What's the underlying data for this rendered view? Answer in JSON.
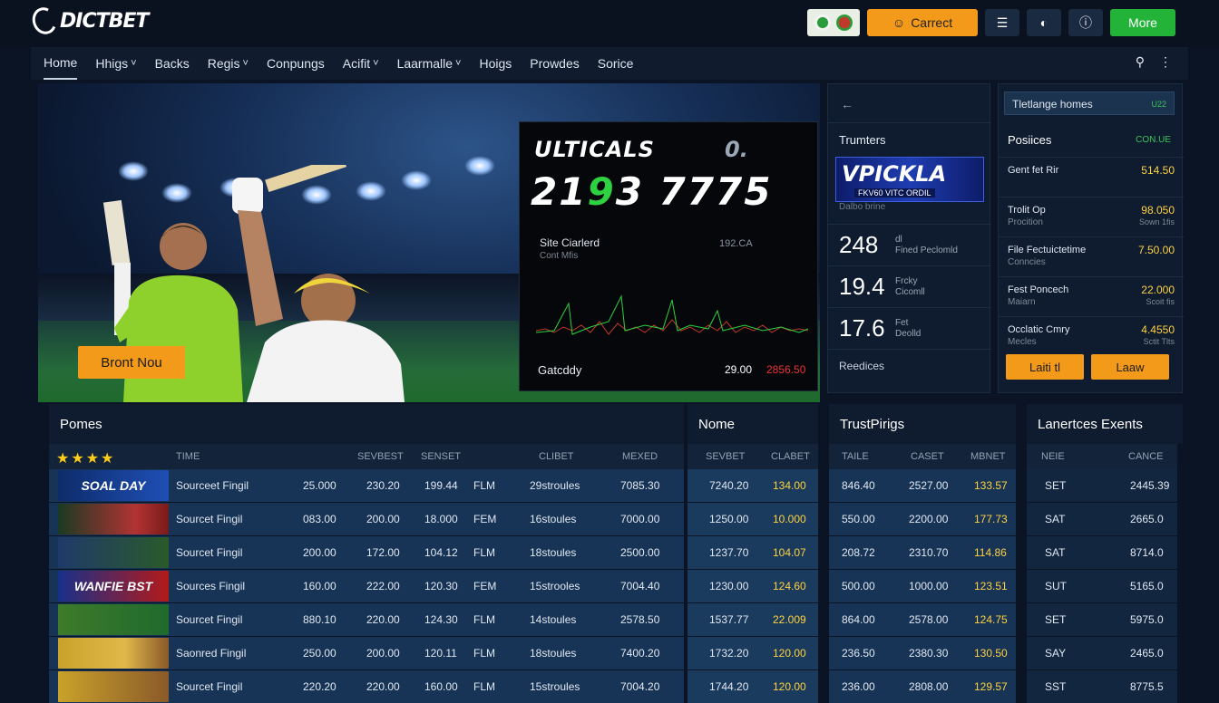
{
  "app": {
    "logo": "DICTBET"
  },
  "topbar": {
    "primary_label": "Carrect",
    "more_label": "More"
  },
  "nav": {
    "items": [
      {
        "label": "Home",
        "dropdown": false
      },
      {
        "label": "Hhigs",
        "dropdown": true
      },
      {
        "label": "Backs",
        "dropdown": false
      },
      {
        "label": "Regis",
        "dropdown": true
      },
      {
        "label": "Conpungs",
        "dropdown": false
      },
      {
        "label": "Acifit",
        "dropdown": true
      },
      {
        "label": "Laarmalle",
        "dropdown": true
      },
      {
        "label": "Hoigs",
        "dropdown": false
      },
      {
        "label": "Prowdes",
        "dropdown": false
      },
      {
        "label": "Sorice",
        "dropdown": false
      }
    ]
  },
  "hero": {
    "cta": "Bront Nou",
    "scoreboard": {
      "title": "ULTICALS",
      "title_right": "0.",
      "score_a": "21",
      "score_g": "9",
      "score_b": "3 7775",
      "label": "Site Ciarlerd",
      "sublabel": "Cont Mfis",
      "right_label": "192.CA",
      "footer_label": "Gatcddy",
      "footer_val1": "29.00",
      "footer_val2": "2856.50"
    }
  },
  "stats_panel": {
    "title": "Trumters",
    "banner_title": "VPICKLA",
    "banner_sub": "FKV60   VITC ORDIL",
    "banner_caption": "Dalbo brine",
    "rows": [
      {
        "value": "248",
        "line1": "dl",
        "line2": "Fined Peclomld"
      },
      {
        "value": "19.4",
        "line1": "Frcky",
        "line2": "Cicomll"
      },
      {
        "value": "17.6",
        "line1": "Fet",
        "line2": "Deolld"
      }
    ],
    "bottom": "Reedices"
  },
  "odds_panel": {
    "header": "Tletlange homes",
    "header_tag": "U22",
    "title": "Posiices",
    "title_right": "CON.UE",
    "rows": [
      {
        "name": "Gent fet Rir",
        "sub": "",
        "value": "514.50",
        "value_sub": ""
      },
      {
        "name": "Trolit Op",
        "sub": "Procition",
        "value": "98.050",
        "value_sub": "Sown 1fis"
      },
      {
        "name": "File Fectuictetime",
        "sub": "Conncies",
        "value": "7.50.00",
        "value_sub": ""
      },
      {
        "name": "Fest Poncech",
        "sub": "Maiarn",
        "value": "22.000",
        "value_sub": "Scoit fis"
      },
      {
        "name": "Occlatic Cmry",
        "sub": "Mecles",
        "value": "4.4550",
        "value_sub": "Sctit Tlts"
      }
    ],
    "btn1": "Laiti tl",
    "btn2": "Laaw"
  },
  "table": {
    "sections": {
      "a": "Pomes",
      "b": "Nome",
      "c": "TrustPirigs",
      "d": "Lanertces Exents"
    },
    "headers": {
      "time": "TIME",
      "sevbest": "SEVBEST",
      "senset": "SENSET",
      "clibet": "CLIBET",
      "mexed": "MEXED",
      "sevbet": "SEVBET",
      "clabet": "CLABET",
      "taile": "TAILE",
      "caset": "CASET",
      "mbnet": "MBNET",
      "neie": "NEIE",
      "cance": "CANCE"
    },
    "rows": [
      {
        "thumb": "SOAL DAY",
        "name": "Sourceet Fingil",
        "c1": "25.000",
        "c2": "230.20",
        "c3": "199.44",
        "c4": "FLM",
        "c5": "29stroules",
        "c6": "7085.30",
        "c7": "7240.20",
        "c8": "134.00",
        "c9": "846.40",
        "c10": "2527.00",
        "c11": "133.57",
        "c12": "SET",
        "c13": "2445.39"
      },
      {
        "thumb": "",
        "name": "Sourcet Fingil",
        "c1": "083.00",
        "c2": "200.00",
        "c3": "18.000",
        "c4": "FEM",
        "c5": "16stoules",
        "c6": "7000.00",
        "c7": "1250.00",
        "c8": "10.000",
        "c9": "550.00",
        "c10": "2200.00",
        "c11": "177.73",
        "c12": "SAT",
        "c13": "2665.0"
      },
      {
        "thumb": "",
        "name": "Sourcet Fingil",
        "c1": "200.00",
        "c2": "172.00",
        "c3": "104.12",
        "c4": "FLM",
        "c5": "18stoules",
        "c6": "2500.00",
        "c7": "1237.70",
        "c8": "104.07",
        "c9": "208.72",
        "c10": "2310.70",
        "c11": "114.86",
        "c12": "SAT",
        "c13": "8714.0"
      },
      {
        "thumb": "WANFIE BST",
        "name": "Sources Fingil",
        "c1": "160.00",
        "c2": "222.00",
        "c3": "120.30",
        "c4": "FEM",
        "c5": "15strooles",
        "c6": "7004.40",
        "c7": "1230.00",
        "c8": "124.60",
        "c9": "500.00",
        "c10": "1000.00",
        "c11": "123.51",
        "c12": "SUT",
        "c13": "5165.0"
      },
      {
        "thumb": "",
        "name": "Sourcet Fingil",
        "c1": "880.10",
        "c2": "220.00",
        "c3": "124.30",
        "c4": "FLM",
        "c5": "14stoules",
        "c6": "2578.50",
        "c7": "1537.77",
        "c8": "22.009",
        "c9": "864.00",
        "c10": "2578.00",
        "c11": "124.75",
        "c12": "SET",
        "c13": "5975.0"
      },
      {
        "thumb": "",
        "name": "Saonred Fingil",
        "c1": "250.00",
        "c2": "200.00",
        "c3": "120.11",
        "c4": "FLM",
        "c5": "18stoules",
        "c6": "7400.20",
        "c7": "1732.20",
        "c8": "120.00",
        "c9": "236.50",
        "c10": "2380.30",
        "c11": "130.50",
        "c12": "SAY",
        "c13": "2465.0"
      },
      {
        "thumb": "",
        "name": "Sourcet Fingil",
        "c1": "220.20",
        "c2": "220.00",
        "c3": "160.00",
        "c4": "FLM",
        "c5": "15stroules",
        "c6": "7004.20",
        "c7": "1744.20",
        "c8": "120.00",
        "c9": "236.00",
        "c10": "2808.00",
        "c11": "129.57",
        "c12": "SST",
        "c13": "8775.5"
      }
    ]
  }
}
